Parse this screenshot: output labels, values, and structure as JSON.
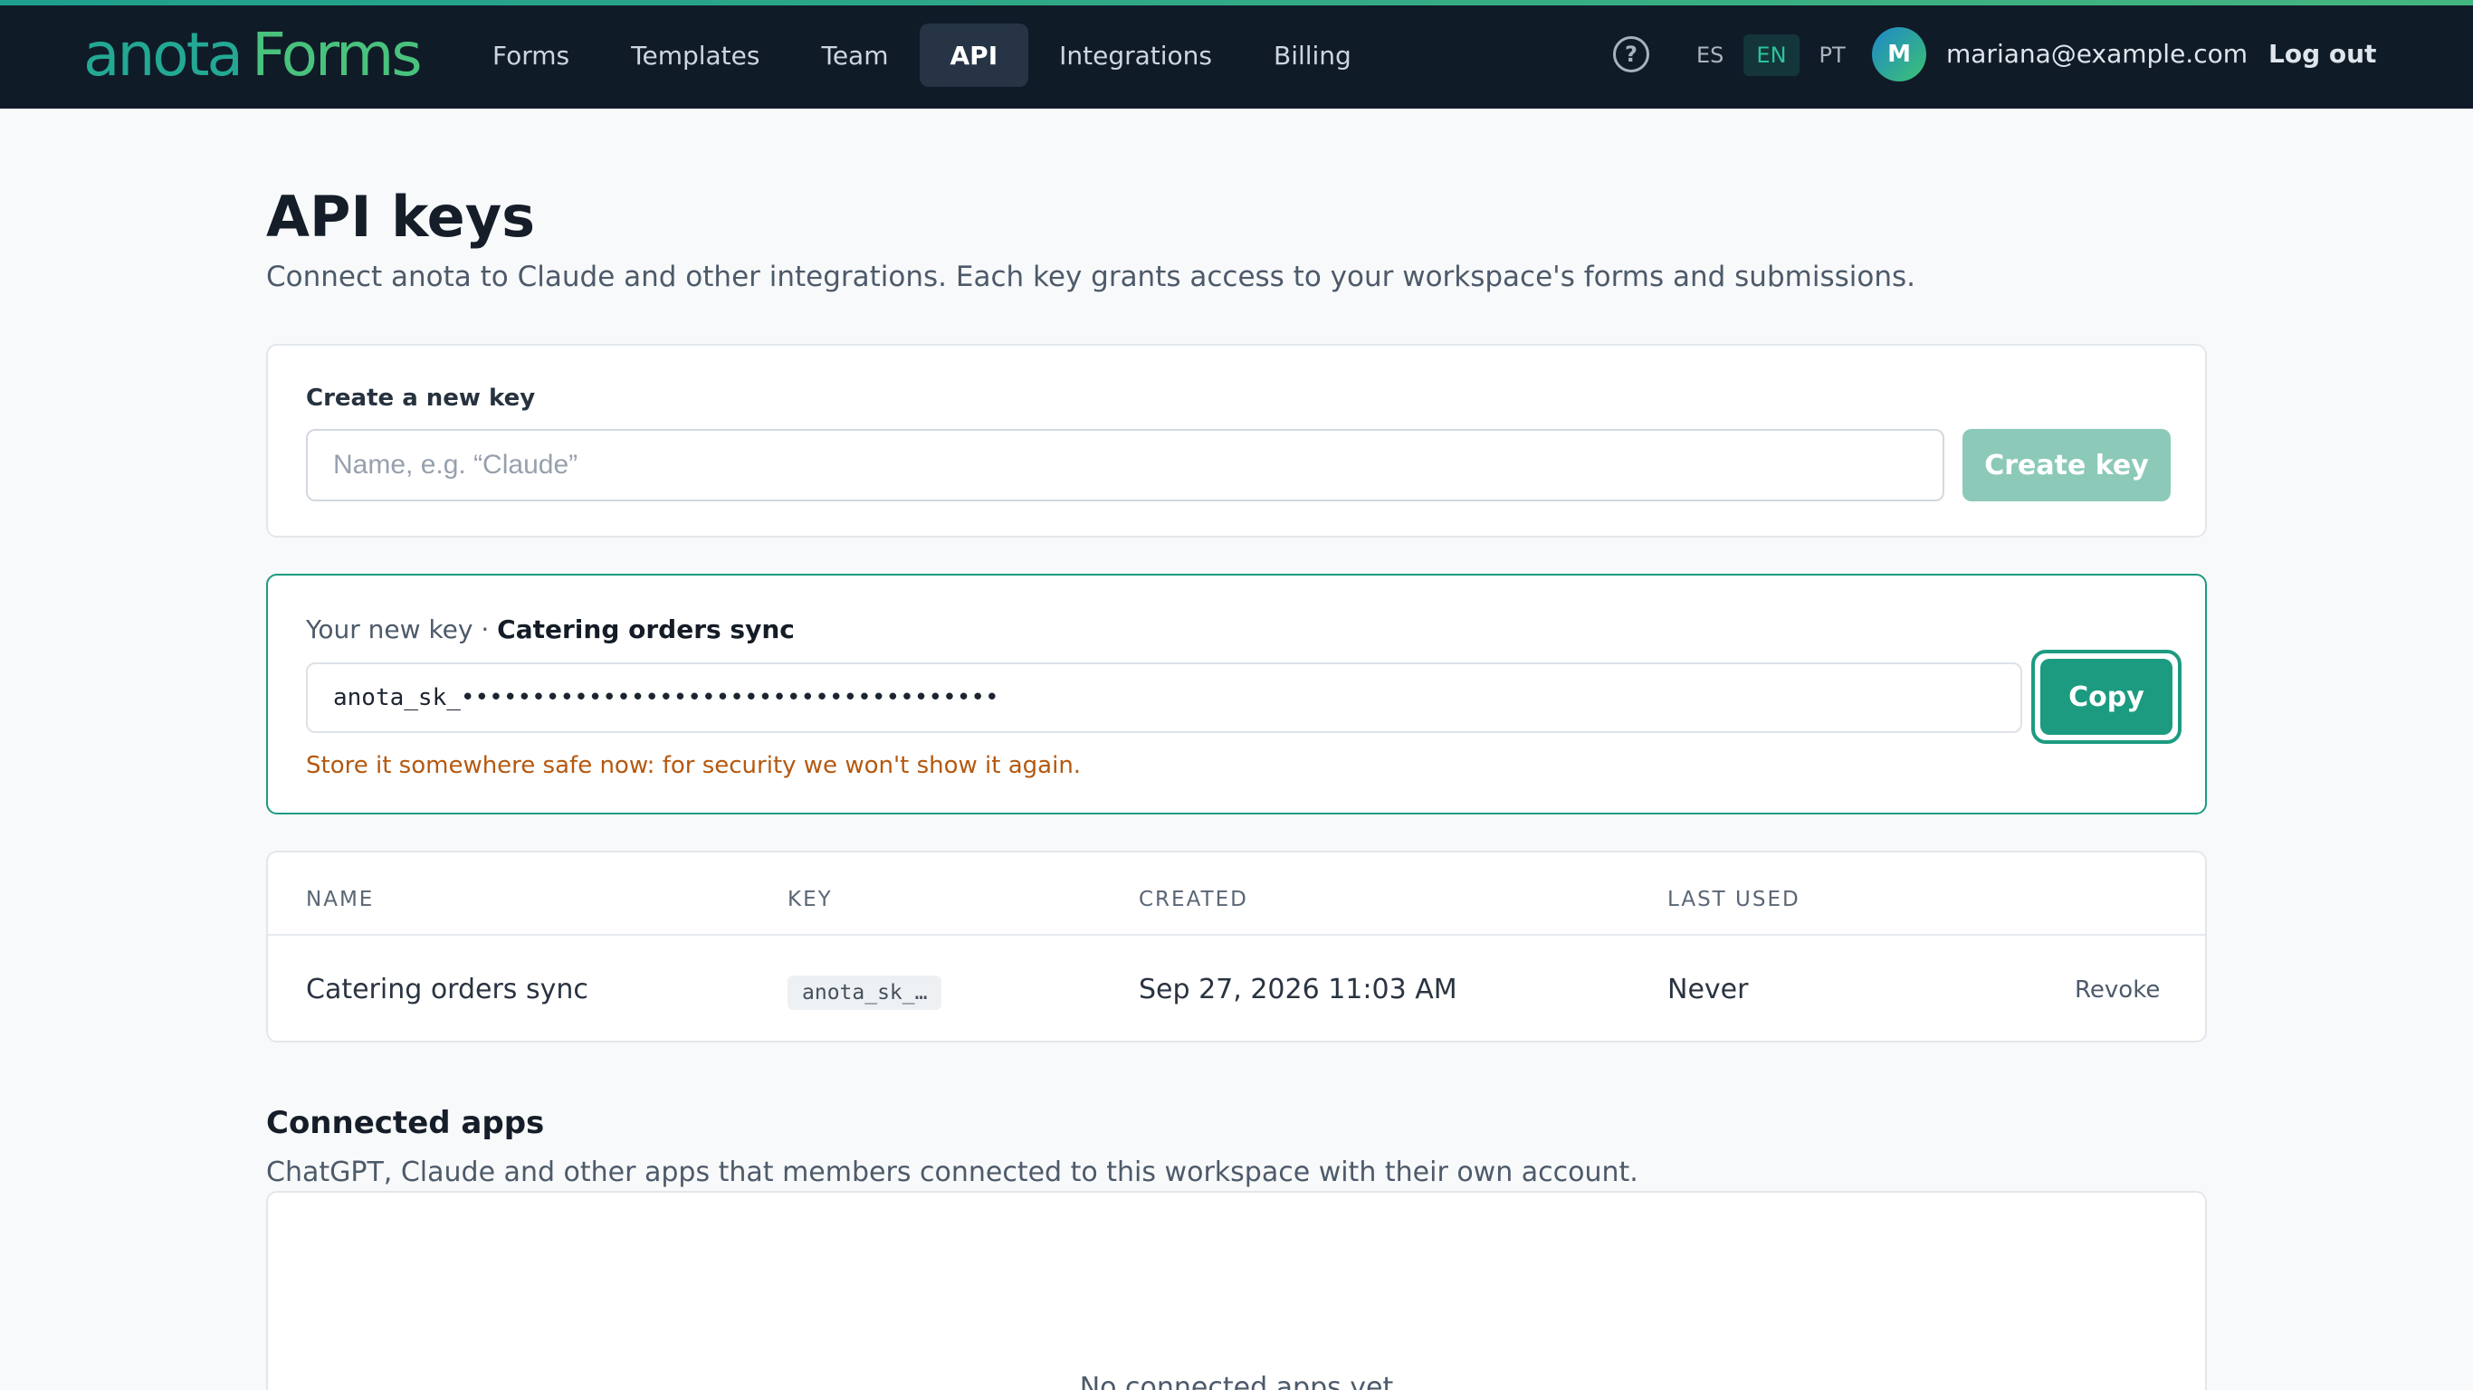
{
  "header": {
    "logo_part1": "anota",
    "logo_part2": "Forms",
    "nav": [
      "Forms",
      "Templates",
      "Team",
      "API",
      "Integrations",
      "Billing"
    ],
    "active_nav": "API",
    "help_glyph": "?",
    "languages": [
      "ES",
      "EN",
      "PT"
    ],
    "active_language": "EN",
    "avatar_initial": "M",
    "user_email": "mariana@example.com",
    "logout_label": "Log out"
  },
  "page": {
    "title": "API keys",
    "subtitle": "Connect anota to Claude and other integrations. Each key grants access to your workspace's forms and submissions."
  },
  "create_key": {
    "label": "Create a new key",
    "placeholder": "Name, e.g. “Claude”",
    "value": "",
    "button_label": "Create key"
  },
  "new_key": {
    "prefix_label": "Your new key ·",
    "name": "Catering orders sync",
    "masked_value": "anota_sk_••••••••••••••••••••••••••••••••••••••",
    "copy_label": "Copy",
    "warning": "Store it somewhere safe now: for security we won't show it again."
  },
  "keys_table": {
    "headers": {
      "name": "NAME",
      "key": "KEY",
      "created": "CREATED",
      "last_used": "LAST USED"
    },
    "rows": [
      {
        "name": "Catering orders sync",
        "key": "anota_sk_…",
        "created": "Sep 27, 2026 11:03 AM",
        "last_used": "Never",
        "action": "Revoke"
      }
    ]
  },
  "connected_apps": {
    "title": "Connected apps",
    "subtitle": "ChatGPT, Claude and other apps that members connected to this workspace with their own account.",
    "empty_message": "No connected apps yet"
  },
  "colors": {
    "topbar": "#101b28",
    "accent": "#1c9b80",
    "warning": "#b5580f"
  },
  "icons": {
    "help": "question-circle-icon"
  }
}
